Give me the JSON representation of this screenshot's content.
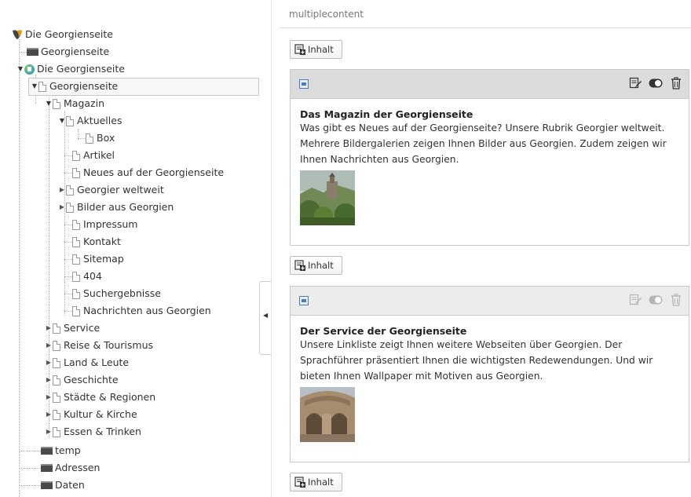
{
  "tree": {
    "rows": [
      {
        "label": "Die Georgienseite",
        "icon": "typo3-icon"
      },
      {
        "label": "Georgienseite",
        "icon": "folder-icon"
      },
      {
        "label": "Die Georgienseite",
        "icon": "shortcut-icon"
      },
      {
        "label": "Georgienseite",
        "icon": "page-icon"
      },
      {
        "label": "Magazin",
        "icon": "page-icon"
      },
      {
        "label": "Aktuelles",
        "icon": "page-icon"
      },
      {
        "label": "Box",
        "icon": "page-icon"
      },
      {
        "label": "Artikel",
        "icon": "page-icon"
      },
      {
        "label": "Neues auf der Georgienseite",
        "icon": "page-icon"
      },
      {
        "label": "Georgier weltweit",
        "icon": "page-icon"
      },
      {
        "label": "Bilder aus Georgien",
        "icon": "page-icon"
      },
      {
        "label": "Impressum",
        "icon": "page-icon"
      },
      {
        "label": "Kontakt",
        "icon": "page-icon"
      },
      {
        "label": "Sitemap",
        "icon": "page-icon"
      },
      {
        "label": "404",
        "icon": "page-icon"
      },
      {
        "label": "Suchergebnisse",
        "icon": "page-icon"
      },
      {
        "label": "Nachrichten aus Georgien",
        "icon": "page-icon"
      },
      {
        "label": "Service",
        "icon": "page-icon"
      },
      {
        "label": "Reise & Tourismus",
        "icon": "page-icon"
      },
      {
        "label": "Land & Leute",
        "icon": "page-icon"
      },
      {
        "label": "Geschichte",
        "icon": "page-icon"
      },
      {
        "label": "Städte & Regionen",
        "icon": "page-icon"
      },
      {
        "label": "Kultur & Kirche",
        "icon": "page-icon"
      },
      {
        "label": "Essen & Trinken",
        "icon": "page-icon"
      },
      {
        "label": "temp",
        "icon": "folder-icon"
      },
      {
        "label": "Adressen",
        "icon": "folder-icon"
      },
      {
        "label": "Daten",
        "icon": "folder-icon"
      }
    ]
  },
  "content": {
    "column_header": "multiplecontent",
    "new_content_label": "Inhalt",
    "elements": [
      {
        "title": "Das Magazin der Georgienseite",
        "text": "Was gibt es Neues auf der Georgienseite? Unsere Rubrik Georgier weltweit. Mehrere Bildergalerien zeigen Ihnen Bilder aus Georgien. Zudem zeigen wir Ihnen Nachrichten aus Georgien.",
        "image": "landscape-castle-thumbnail"
      },
      {
        "title": "Der Service der Georgienseite",
        "text": "Unsere Linkliste zeigt Ihnen weitere Webseiten über Georgien. Der Sprachführer präsentiert Ihnen die wichtigsten Redewendungen. Und wir bieten Ihnen Wallpaper mit Motiven aus Georgien.",
        "image": "stone-arch-thumbnail"
      }
    ]
  }
}
